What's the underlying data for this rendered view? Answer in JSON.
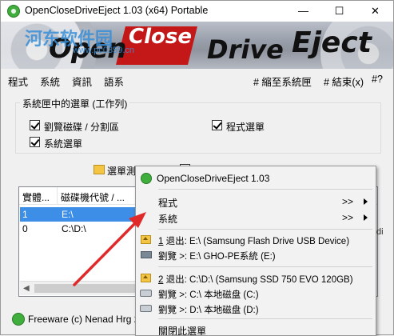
{
  "window": {
    "title": "OpenCloseDriveEject 1.03  (x64) Portable",
    "minimize_glyph": "—",
    "maximize_glyph": "☐",
    "close_glyph": "✕"
  },
  "banner": {
    "words": [
      "Open",
      "Close",
      "Drive",
      "Eject"
    ],
    "watermark": "河东软件园",
    "watermark_url": "www.pc0359.cn"
  },
  "menubar": {
    "items": [
      "程式",
      "系統",
      "資訊",
      "語系"
    ],
    "right_items": [
      "# 縮至系統匣",
      "# 結束(x)",
      "#?"
    ]
  },
  "group": {
    "title": "系統匣中的選單 (工作列)",
    "checkboxes": [
      {
        "label": "劉覽磁碟 / 分割區",
        "checked": true
      },
      {
        "label": "程式選單",
        "checked": true
      },
      {
        "label": "系統選單",
        "checked": true
      }
    ]
  },
  "toolbar": {
    "label": "選單測試"
  },
  "list": {
    "columns": [
      "實體...",
      "磁碟機代號 / ..."
    ],
    "rows": [
      {
        "num": "1",
        "drive": "E:\\",
        "selected": true
      },
      {
        "num": "0",
        "drive": "C:\\D:\\",
        "selected": false
      }
    ],
    "right_fragment": "di",
    "scroll_left_glyph": "◀"
  },
  "footer": {
    "text": "Freeware (c) Nenad Hrg 20"
  },
  "popup": {
    "header": "OpenCloseDriveEject 1.03",
    "items": [
      {
        "label": "程式",
        "arrow": ">>"
      },
      {
        "label": "系統",
        "arrow": ">>"
      }
    ],
    "drives": [
      {
        "index": "1",
        "eject": "退出: E:\\  (Samsung Flash Drive USB Device)",
        "browse": [
          {
            "text": "劉覽 >: E:\\ GHO-PE系統 (E:)",
            "icon": "usb-drive-icon"
          }
        ]
      },
      {
        "index": "2",
        "eject": "退出: C:\\D:\\  (Samsung SSD 750 EVO 120GB)",
        "browse": [
          {
            "text": "劉覽 >: C:\\ 本地磁盘 (C:)",
            "icon": "hard-disk-icon"
          },
          {
            "text": "劉覽 >: D:\\ 本地磁盘 (D:)",
            "icon": "hard-disk-icon"
          }
        ]
      }
    ],
    "close_menu": "關閉此選單"
  },
  "colors": {
    "selection": "#3d8ee6",
    "annotation_arrow": "#e02a2a",
    "banner_red": "#c41717"
  }
}
